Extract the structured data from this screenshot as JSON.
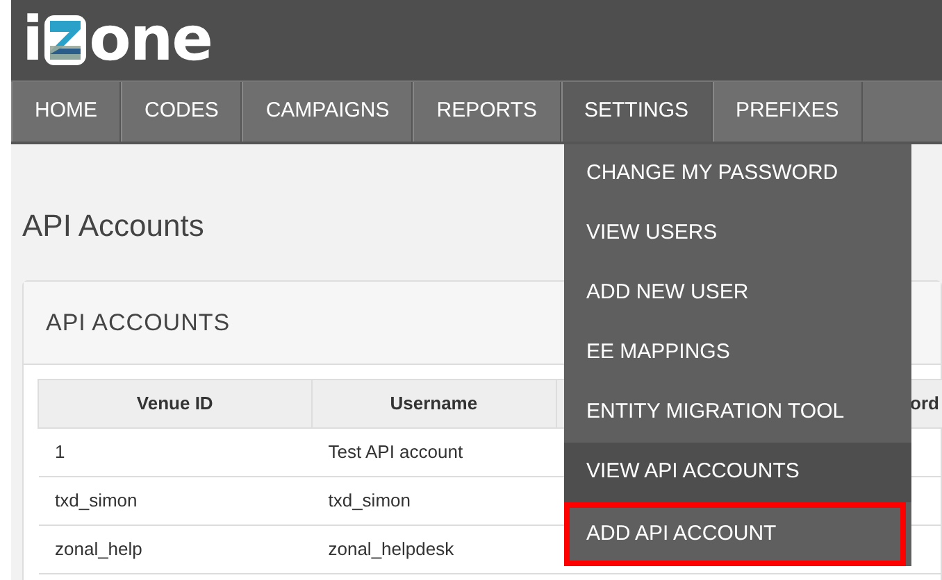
{
  "logo": {
    "text_before": "i",
    "text_after": "one"
  },
  "nav": [
    {
      "label": "HOME",
      "selected": false
    },
    {
      "label": "CODES",
      "selected": false
    },
    {
      "label": "CAMPAIGNS",
      "selected": false
    },
    {
      "label": "REPORTS",
      "selected": false
    },
    {
      "label": "SETTINGS",
      "selected": true
    },
    {
      "label": "PREFIXES",
      "selected": false
    }
  ],
  "settings_menu": [
    {
      "label": "CHANGE MY PASSWORD",
      "hovered": false,
      "annotated": false
    },
    {
      "label": "VIEW USERS",
      "hovered": false,
      "annotated": false
    },
    {
      "label": "ADD NEW USER",
      "hovered": false,
      "annotated": false
    },
    {
      "label": "EE MAPPINGS",
      "hovered": false,
      "annotated": false
    },
    {
      "label": "ENTITY MIGRATION TOOL",
      "hovered": false,
      "annotated": false
    },
    {
      "label": "VIEW API ACCOUNTS",
      "hovered": true,
      "annotated": false
    },
    {
      "label": "ADD API ACCOUNT",
      "hovered": false,
      "annotated": true
    }
  ],
  "page_title": "API Accounts",
  "card_title": "API ACCOUNTS",
  "table": {
    "columns": [
      "Venue ID",
      "Username",
      "ord"
    ],
    "rows": [
      [
        "1",
        "Test API account"
      ],
      [
        "txd_simon",
        "txd_simon"
      ],
      [
        "zonal_help",
        "zonal_helpdesk"
      ]
    ]
  }
}
